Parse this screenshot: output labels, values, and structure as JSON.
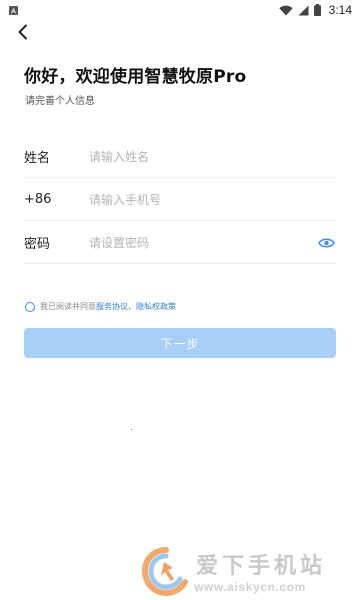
{
  "status_bar": {
    "time": "3:14",
    "icons": [
      "app-notification-icon",
      "wifi-icon",
      "signal-icon",
      "battery-icon"
    ]
  },
  "header": {
    "back_icon": "back-arrow-icon",
    "title": "你好，欢迎使用智慧牧原Pro",
    "subtitle": "请完善个人信息"
  },
  "form": {
    "name": {
      "label": "姓名",
      "placeholder": "请输入姓名",
      "value": ""
    },
    "phone": {
      "label": "+86",
      "placeholder": "请输入手机号",
      "value": ""
    },
    "password": {
      "label": "密码",
      "placeholder": "请设置密码",
      "value": "",
      "toggle_icon": "eye-icon"
    }
  },
  "agreement": {
    "prefix": "我已阅读并同意",
    "service_link": "服务协议",
    "separator": "、",
    "privacy_link": "隐私权政策",
    "checked": false
  },
  "actions": {
    "next_label": "下一步"
  },
  "watermark": {
    "title": "爱下手机站",
    "url": "www.aiskycn.com"
  },
  "colors": {
    "accent": "#2f82d8",
    "button_disabled": "#a8cff5",
    "placeholder": "#b4b4b4",
    "divider": "#ececec"
  }
}
